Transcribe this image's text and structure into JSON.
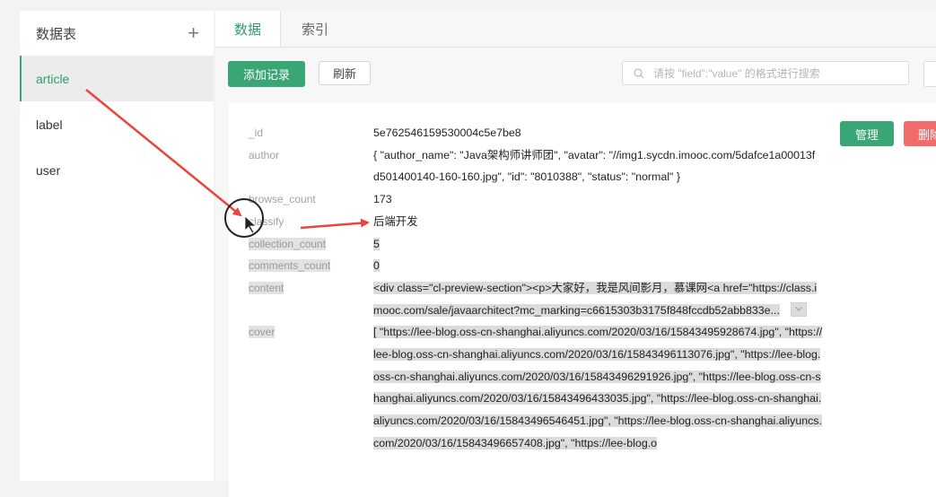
{
  "sidebar": {
    "title": "数据表",
    "add_icon": "plus-icon",
    "items": [
      {
        "label": "article",
        "active": true
      },
      {
        "label": "label",
        "active": false
      },
      {
        "label": "user",
        "active": false
      }
    ]
  },
  "tabs": [
    {
      "label": "数据",
      "active": true
    },
    {
      "label": "索引",
      "active": false
    }
  ],
  "toolbar": {
    "add_label": "添加记录",
    "refresh_label": "刷新",
    "search_placeholder": "请按 \"field\":\"value\" 的格式进行搜索"
  },
  "record": {
    "manage_label": "管理",
    "delete_label": "删除",
    "fields": [
      {
        "key": "_id",
        "value": "5e762546159530004c5e7be8"
      },
      {
        "key": "author",
        "value": "{ \"author_name\": \"Java架构师讲师团\", \"avatar\": \"//img1.sycdn.imooc.com/5dafce1a00013fd501400140-160-160.jpg\", \"id\": \"8010388\", \"status\": \"normal\" }"
      },
      {
        "key": "browse_count",
        "value": "173"
      },
      {
        "key": "classify",
        "value": "后端开发"
      },
      {
        "key": "collection_count",
        "value": "5"
      },
      {
        "key": "comments_count",
        "value": "0"
      },
      {
        "key": "content",
        "value": "<div class=\"cl-preview-section\"><p>大家好，我是风间影月，慕课网<a href=\"https://class.imooc.com/sale/javaarchitect?mc_marking=c6615303b3175f848fccdb52abb833e..."
      },
      {
        "key": "cover",
        "value": "[ \"https://lee-blog.oss-cn-shanghai.aliyuncs.com/2020/03/16/15843495928674.jpg\", \"https://lee-blog.oss-cn-shanghai.aliyuncs.com/2020/03/16/15843496113076.jpg\", \"https://lee-blog.oss-cn-shanghai.aliyuncs.com/2020/03/16/15843496291926.jpg\", \"https://lee-blog.oss-cn-shanghai.aliyuncs.com/2020/03/16/15843496433035.jpg\", \"https://lee-blog.oss-cn-shanghai.aliyuncs.com/2020/03/16/15843496546451.jpg\", \"https://lee-blog.oss-cn-shanghai.aliyuncs.com/2020/03/16/15843496657408.jpg\", \"https://lee-blog.o"
      }
    ]
  },
  "colors": {
    "accent": "#3aa676",
    "danger": "#f26b6b",
    "annotation": "#e8453c"
  }
}
